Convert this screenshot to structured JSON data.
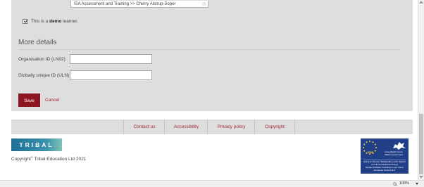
{
  "form": {
    "breadcrumb_select_value": "ISA Assessment and Training >> Cherry Aistrup-Soper",
    "demo_checkbox": {
      "checked": true,
      "text_before": "This is a ",
      "text_bold": "demo",
      "text_after": " learner."
    },
    "section_title": "More details",
    "fields": [
      {
        "label": "Organisation ID (LN02)",
        "value": ""
      },
      {
        "label": "Globally unique ID (ULN)",
        "value": ""
      }
    ],
    "save_label": "Save",
    "cancel_label": "Cancel"
  },
  "footer": {
    "links": [
      "Contact us",
      "Accessibility",
      "Privacy policy",
      "Copyright"
    ],
    "logo_text": "TRIBAL",
    "copyright_text": "Copyright",
    "copyright_mark": "©",
    "copyright_owner": " Tribal Education Ltd 2021",
    "esf": {
      "label": "ESF",
      "line1": "Llywodraeth Cymru",
      "line2": "Welsh Government",
      "line3": "Ewrop & Chymru: Buddsoddi yn eich dyfodol",
      "line4": "Cronfa Gymdeithasol Ewrop",
      "line5": "Europe & Wales: Investing in your future",
      "line6": "European Social Fund"
    }
  },
  "status_bar": {
    "zoom": "100%"
  },
  "colors": {
    "accent": "#8d1720",
    "link": "#a12833",
    "panel_bg": "#dedede",
    "esf_blue": "#213f86"
  }
}
